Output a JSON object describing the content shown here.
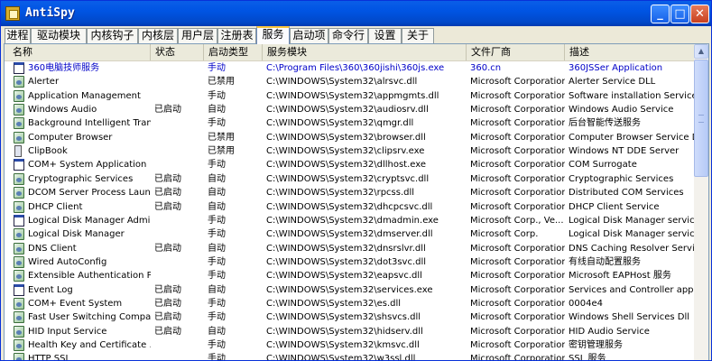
{
  "window": {
    "title": "AntiSpy",
    "minimize_glyph": "_",
    "maximize_glyph": "□",
    "close_glyph": "✕"
  },
  "tabs": [
    {
      "label": "进程"
    },
    {
      "label": "驱动模块"
    },
    {
      "label": "内核钩子"
    },
    {
      "label": "内核层"
    },
    {
      "label": "用户层"
    },
    {
      "label": "注册表"
    },
    {
      "label": "服务"
    },
    {
      "label": "启动项"
    },
    {
      "label": "命令行"
    },
    {
      "label": "设置"
    },
    {
      "label": "关于"
    }
  ],
  "active_tab": "服务",
  "columns": {
    "name": "名称",
    "status": "状态",
    "start_type": "启动类型",
    "module": "服务模块",
    "vendor": "文件厂商",
    "desc": "描述"
  },
  "colors": {
    "highlight_text": "#0000c8",
    "title_bar": "#0054e3"
  },
  "rows": [
    {
      "icon": "window-icon",
      "name": "360电脑技师服务",
      "status": "",
      "start": "手动",
      "module": "C:\\Program Files\\360\\360jishi\\360js.exe",
      "vendor": "360.cn",
      "desc": "360JSSer Application"
    },
    {
      "icon": "service-icon",
      "name": "Alerter",
      "status": "",
      "start": "已禁用",
      "module": "C:\\WINDOWS\\System32\\alrsvc.dll",
      "vendor": "Microsoft Corporation",
      "desc": "Alerter Service DLL"
    },
    {
      "icon": "service-icon",
      "name": "Application Management",
      "status": "",
      "start": "手动",
      "module": "C:\\WINDOWS\\System32\\appmgmts.dll",
      "vendor": "Microsoft Corporation",
      "desc": "Software installation Service"
    },
    {
      "icon": "service-icon",
      "name": "Windows Audio",
      "status": "已启动",
      "start": "自动",
      "module": "C:\\WINDOWS\\System32\\audiosrv.dll",
      "vendor": "Microsoft Corporation",
      "desc": "Windows Audio Service"
    },
    {
      "icon": "service-icon",
      "name": "Background Intelligent Tran...",
      "status": "",
      "start": "手动",
      "module": "C:\\WINDOWS\\System32\\qmgr.dll",
      "vendor": "Microsoft Corporation",
      "desc": "后台智能传送服务"
    },
    {
      "icon": "service-icon",
      "name": "Computer Browser",
      "status": "",
      "start": "已禁用",
      "module": "C:\\WINDOWS\\System32\\browser.dll",
      "vendor": "Microsoft Corporation",
      "desc": "Computer Browser Service DLL"
    },
    {
      "icon": "clipbook-icon",
      "name": "ClipBook",
      "status": "",
      "start": "已禁用",
      "module": "C:\\WINDOWS\\System32\\clipsrv.exe",
      "vendor": "Microsoft Corporation",
      "desc": "Windows NT DDE Server"
    },
    {
      "icon": "window-icon",
      "name": "COM+ System Application",
      "status": "",
      "start": "手动",
      "module": "C:\\WINDOWS\\System32\\dllhost.exe",
      "vendor": "Microsoft Corporation",
      "desc": "COM Surrogate"
    },
    {
      "icon": "service-icon",
      "name": "Cryptographic Services",
      "status": "已启动",
      "start": "自动",
      "module": "C:\\WINDOWS\\System32\\cryptsvc.dll",
      "vendor": "Microsoft Corporation",
      "desc": "Cryptographic Services"
    },
    {
      "icon": "service-icon",
      "name": "DCOM Server Process Laun...",
      "status": "已启动",
      "start": "自动",
      "module": "C:\\WINDOWS\\System32\\rpcss.dll",
      "vendor": "Microsoft Corporation",
      "desc": "Distributed COM Services"
    },
    {
      "icon": "service-icon",
      "name": "DHCP Client",
      "status": "已启动",
      "start": "自动",
      "module": "C:\\WINDOWS\\System32\\dhcpcsvc.dll",
      "vendor": "Microsoft Corporation",
      "desc": "DHCP Client Service"
    },
    {
      "icon": "window-icon",
      "name": "Logical Disk Manager Admini...",
      "status": "",
      "start": "手动",
      "module": "C:\\WINDOWS\\System32\\dmadmin.exe",
      "vendor": "Microsoft Corp., Ve...",
      "desc": "Logical Disk Manager service p..."
    },
    {
      "icon": "service-icon",
      "name": "Logical Disk Manager",
      "status": "",
      "start": "手动",
      "module": "C:\\WINDOWS\\System32\\dmserver.dll",
      "vendor": "Microsoft Corp.",
      "desc": "Logical Disk Manager service dll"
    },
    {
      "icon": "service-icon",
      "name": "DNS Client",
      "status": "已启动",
      "start": "自动",
      "module": "C:\\WINDOWS\\System32\\dnsrslvr.dll",
      "vendor": "Microsoft Corporation",
      "desc": "DNS Caching Resolver Service"
    },
    {
      "icon": "service-icon",
      "name": "Wired AutoConfig",
      "status": "",
      "start": "手动",
      "module": "C:\\WINDOWS\\System32\\dot3svc.dll",
      "vendor": "Microsoft Corporation",
      "desc": "有线自动配置服务"
    },
    {
      "icon": "service-icon",
      "name": "Extensible Authentication P...",
      "status": "",
      "start": "手动",
      "module": "C:\\WINDOWS\\System32\\eapsvc.dll",
      "vendor": "Microsoft Corporation",
      "desc": "Microsoft EAPHost 服务"
    },
    {
      "icon": "window-icon",
      "name": "Event Log",
      "status": "已启动",
      "start": "自动",
      "module": "C:\\WINDOWS\\System32\\services.exe",
      "vendor": "Microsoft Corporation",
      "desc": "Services and Controller app"
    },
    {
      "icon": "service-icon",
      "name": "COM+ Event System",
      "status": "已启动",
      "start": "手动",
      "module": "C:\\WINDOWS\\System32\\es.dll",
      "vendor": "Microsoft Corporation",
      "desc": "0004e4"
    },
    {
      "icon": "service-icon",
      "name": "Fast User Switching Compat...",
      "status": "已启动",
      "start": "手动",
      "module": "C:\\WINDOWS\\System32\\shsvcs.dll",
      "vendor": "Microsoft Corporation",
      "desc": "Windows Shell Services Dll"
    },
    {
      "icon": "service-icon",
      "name": "HID Input Service",
      "status": "已启动",
      "start": "自动",
      "module": "C:\\WINDOWS\\System32\\hidserv.dll",
      "vendor": "Microsoft Corporation",
      "desc": "HID Audio Service"
    },
    {
      "icon": "service-icon",
      "name": "Health Key and Certificate ...",
      "status": "",
      "start": "手动",
      "module": "C:\\WINDOWS\\System32\\kmsvc.dll",
      "vendor": "Microsoft Corporation",
      "desc": "密钥管理服务"
    },
    {
      "icon": "service-icon",
      "name": "HTTP SSL",
      "status": "",
      "start": "手动",
      "module": "C:\\WINDOWS\\System32\\w3ssl.dll",
      "vendor": "Microsoft Corporation",
      "desc": "SSL 服务"
    }
  ]
}
